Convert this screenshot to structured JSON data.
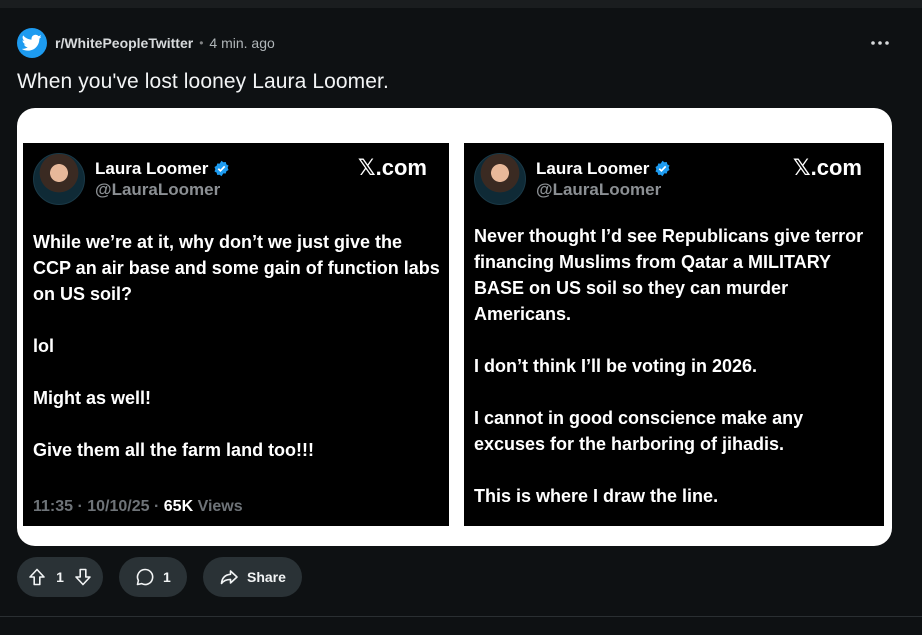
{
  "post": {
    "subreddit": "r/WhitePeopleTwitter",
    "separator": "•",
    "time_ago": "4 min. ago",
    "title": "When you've lost looney Laura Loomer."
  },
  "tweets": [
    {
      "name": "Laura Loomer",
      "handle": "@LauraLoomer",
      "brand": "𝕏.com",
      "paragraphs": [
        "While we’re at it, why don’t we just give the CCP an air base and some gain of function labs on US soil?",
        "lol",
        "Might as well!",
        "Give them all the farm land too!!!"
      ],
      "time": "11:35 · 10/10/25 · ",
      "views_count": "65K",
      "views_label": " Views"
    },
    {
      "name": "Laura Loomer",
      "handle": "@LauraLoomer",
      "brand": "𝕏.com",
      "paragraphs": [
        "Never thought I’d see Republicans give terror financing Muslims from Qatar a MILITARY BASE on US soil so they can murder Americans.",
        "I don’t think I’ll be voting in 2026.",
        "I cannot in good conscience make any excuses for the harboring of jihadis.",
        "This is where I draw the line."
      ]
    }
  ],
  "actions": {
    "upvotes": "1",
    "comments": "1",
    "share_label": "Share"
  },
  "colors": {
    "background": "#0e1113",
    "pill": "#2a3236",
    "reddit_twitter_blue": "#1d9bf0",
    "verified_blue": "#1d9bf0"
  },
  "icons": {
    "subreddit": "twitter-bird-icon",
    "more": "more-horizontal-icon",
    "verified": "verified-badge-icon",
    "upvote": "arrow-up-icon",
    "downvote": "arrow-down-icon",
    "comment": "comment-bubble-icon",
    "share": "share-arrow-icon"
  }
}
